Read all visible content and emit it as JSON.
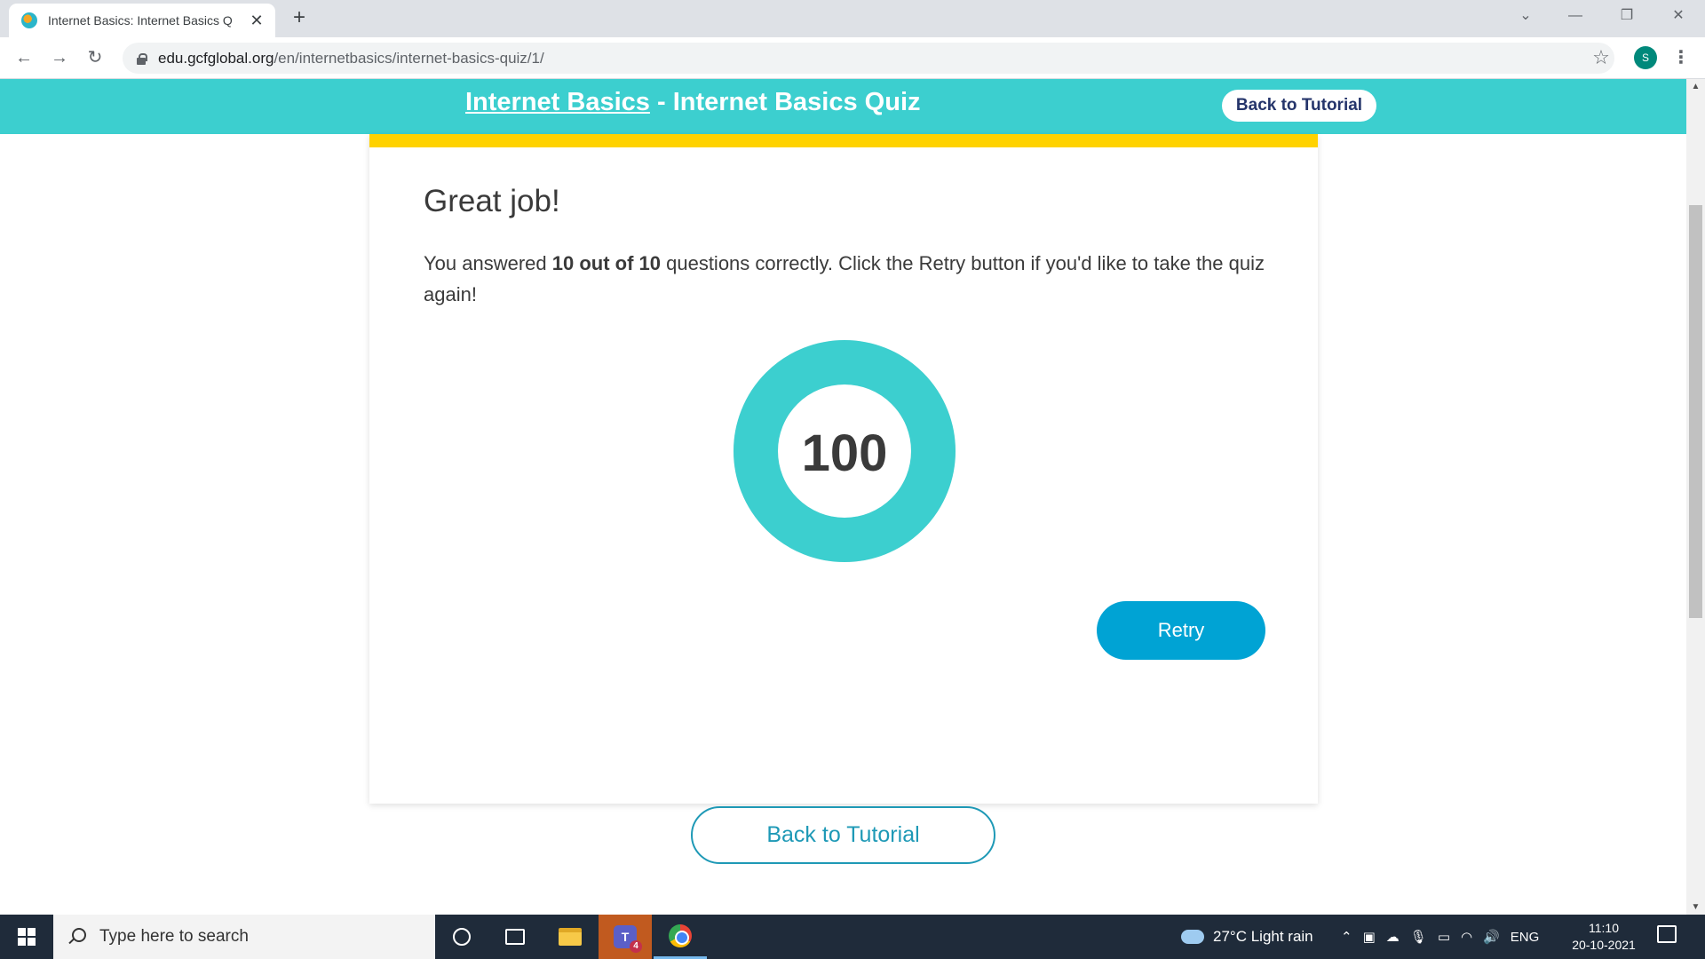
{
  "browser": {
    "tab_title": "Internet Basics: Internet Basics Q",
    "tab_close": "✕",
    "new_tab": "+",
    "url_host": "edu.gcfglobal.org",
    "url_path": "/en/internetbasics/internet-basics-quiz/1/",
    "profile_initial": "S"
  },
  "header": {
    "course_link": "Internet Basics",
    "separator": " - ",
    "page_title": "Internet Basics Quiz",
    "back_button": "Back to Tutorial"
  },
  "result": {
    "heading": "Great job!",
    "text_before": "You answered ",
    "score_phrase": "10 out of 10",
    "text_after": " questions correctly. Click the Retry button if you'd like to take the quiz again!",
    "score": "100",
    "score_fraction": 1.0,
    "retry_button": "Retry"
  },
  "footer": {
    "back_button": "Back to Tutorial"
  },
  "taskbar": {
    "search_placeholder": "Type here to search",
    "teams_badge": "4",
    "weather": "27°C  Light rain",
    "language": "ENG",
    "time": "11:10",
    "date": "20-10-2021"
  },
  "colors": {
    "header_bg": "#3ccfcf",
    "accent_yellow": "#ffd200",
    "donut": "#3ccfcf",
    "retry_bg": "#00a3d4",
    "outline_button": "#1e99b6"
  }
}
